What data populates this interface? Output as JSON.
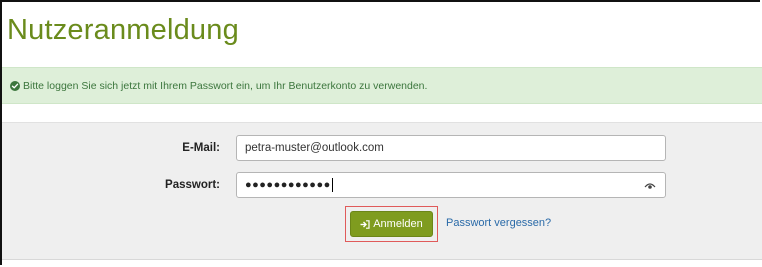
{
  "page": {
    "title": "Nutzeranmeldung"
  },
  "alert": {
    "icon": "check-circle-icon",
    "text": "Bitte loggen Sie sich jetzt mit Ihrem Passwort ein, um Ihr Benutzerkonto zu verwenden.",
    "color": "#3c763d",
    "background": "#deefd9"
  },
  "form": {
    "email_label": "E-Mail:",
    "email_value": "petra-muster@outlook.com",
    "password_label": "Passwort:",
    "password_masked": "●●●●●●●●●●●●",
    "password_toggle_icon": "eye-icon",
    "login_label": "Anmelden",
    "login_icon": "sign-in-icon",
    "forgot_label": "Passwort vergessen?"
  },
  "colors": {
    "brand_green": "#7f9c1f",
    "title_green": "#6a8b1c",
    "link_blue": "#2a6aa8",
    "highlight_red": "#e05a5a"
  }
}
